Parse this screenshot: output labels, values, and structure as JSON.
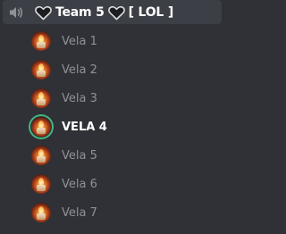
{
  "channel": {
    "name": "Team 5",
    "tag": "[ LOL ]",
    "icons": [
      "speaker-icon",
      "heart-icon",
      "heart-icon"
    ]
  },
  "users": [
    {
      "name": "Vela 1",
      "active": false
    },
    {
      "name": "Vela 2",
      "active": false
    },
    {
      "name": "Vela 3",
      "active": false
    },
    {
      "name": "VELA 4",
      "active": true
    },
    {
      "name": "Vela 5",
      "active": false
    },
    {
      "name": "Vela 6",
      "active": false
    },
    {
      "name": "Vela 7",
      "active": false
    }
  ],
  "colors": {
    "background": "#2f3136",
    "channel_row": "#3c3f45",
    "muted_text": "#8e9297",
    "active_text": "#ffffff",
    "speaking_ring": "#43b581"
  }
}
